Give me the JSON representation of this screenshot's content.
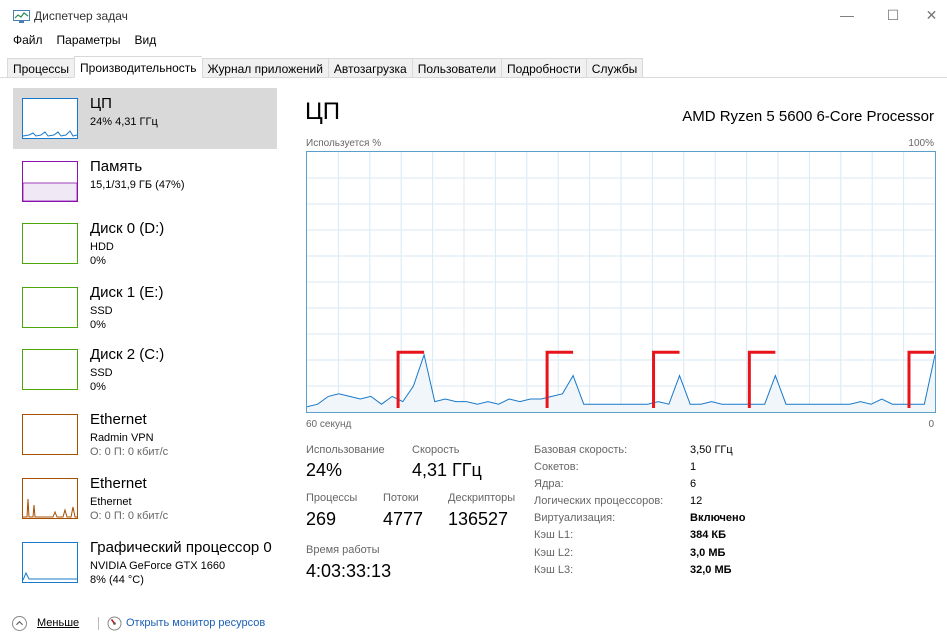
{
  "window": {
    "title": "Диспетчер задач",
    "min_glyph": "—",
    "max_glyph": "☐",
    "close_glyph": "✕"
  },
  "menu": [
    "Файл",
    "Параметры",
    "Вид"
  ],
  "tabs": [
    "Процессы",
    "Производительность",
    "Журнал приложений",
    "Автозагрузка",
    "Пользователи",
    "Подробности",
    "Службы"
  ],
  "active_tab": "Производительность",
  "sidebar": [
    {
      "title": "ЦП",
      "sub1": "24% 4,31 ГГц",
      "sub2": "",
      "color": "#1979ca",
      "selected": true,
      "icon": "cpu-graph-icon"
    },
    {
      "title": "Память",
      "sub1": "15,1/31,9 ГБ (47%)",
      "sub2": "",
      "color": "#8b12ae",
      "selected": false,
      "icon": "memory-graph-icon"
    },
    {
      "title": "Диск 0 (D:)",
      "sub1": "HDD",
      "sub2": "0%",
      "color": "#4da60c",
      "selected": false,
      "icon": "disk-graph-icon"
    },
    {
      "title": "Диск 1 (E:)",
      "sub1": "SSD",
      "sub2": "0%",
      "color": "#4da60c",
      "selected": false,
      "icon": "disk-graph-icon"
    },
    {
      "title": "Диск 2 (C:)",
      "sub1": "SSD",
      "sub2": "0%",
      "color": "#4da60c",
      "selected": false,
      "icon": "disk-graph-icon"
    },
    {
      "title": "Ethernet",
      "sub1": "Radmin VPN",
      "sub2": "О: 0 П: 0 кбит/с",
      "color": "#a74f01",
      "selected": false,
      "icon": "ethernet-graph-icon"
    },
    {
      "title": "Ethernet",
      "sub1": "Ethernet",
      "sub2": "О: 0 П: 0 кбит/с",
      "color": "#a74f01",
      "selected": false,
      "icon": "ethernet-graph-icon"
    },
    {
      "title": "Графический процессор 0",
      "sub1": "NVIDIA GeForce GTX 1660",
      "sub2": "8% (44 °C)",
      "color": "#1979ca",
      "selected": false,
      "icon": "gpu-graph-icon"
    }
  ],
  "main": {
    "title": "ЦП",
    "processor": "AMD Ryzen 5 5600 6-Core Processor",
    "usage_label": "Используется %",
    "pct_max": "100%",
    "time_label": "60 секунд",
    "zero_label": "0"
  },
  "stats": {
    "usage_label": "Использование",
    "usage_value": "24%",
    "speed_label": "Скорость",
    "speed_value": "4,31 ГГц",
    "processes_label": "Процессы",
    "processes_value": "269",
    "threads_label": "Потоки",
    "threads_value": "4777",
    "handles_label": "Дескрипторы",
    "handles_value": "136527",
    "uptime_label": "Время работы",
    "uptime_value": "4:03:33:13"
  },
  "info": [
    {
      "key": "Базовая скорость:",
      "value": "3,50 ГГц"
    },
    {
      "key": "Сокетов:",
      "value": "1"
    },
    {
      "key": "Ядра:",
      "value": "6"
    },
    {
      "key": "Логических процессоров:",
      "value": "12"
    },
    {
      "key": "Виртуализация:",
      "value": "Включено"
    },
    {
      "key": "Кэш L1:",
      "value": "384 КБ"
    },
    {
      "key": "Кэш L2:",
      "value": "3,0 МБ"
    },
    {
      "key": "Кэш L3:",
      "value": "32,0 МБ"
    }
  ],
  "footer": {
    "fewer_label": "Меньше",
    "monitor_link": "Открыть монитор ресурсов"
  },
  "cpu_history": {
    "y_range": [
      0,
      100
    ],
    "x_range": [
      60,
      0
    ],
    "values": [
      2,
      3,
      6,
      7,
      6,
      5,
      6,
      3,
      6,
      4,
      10,
      22,
      4,
      5,
      4,
      4,
      3,
      4,
      3,
      5,
      4,
      5,
      5,
      6,
      7,
      14,
      3,
      3,
      3,
      3,
      3,
      3,
      3,
      4,
      3,
      14,
      3,
      3,
      4,
      3,
      3,
      3,
      3,
      3,
      14,
      3,
      3,
      3,
      3,
      3,
      3,
      3,
      4,
      3,
      5,
      3,
      3,
      3,
      3,
      22
    ],
    "series_color": "#1979ca",
    "fill_color": "#f1f6fa",
    "grid_color": "#d9eaf4",
    "annotation_color": "#e8141b"
  }
}
